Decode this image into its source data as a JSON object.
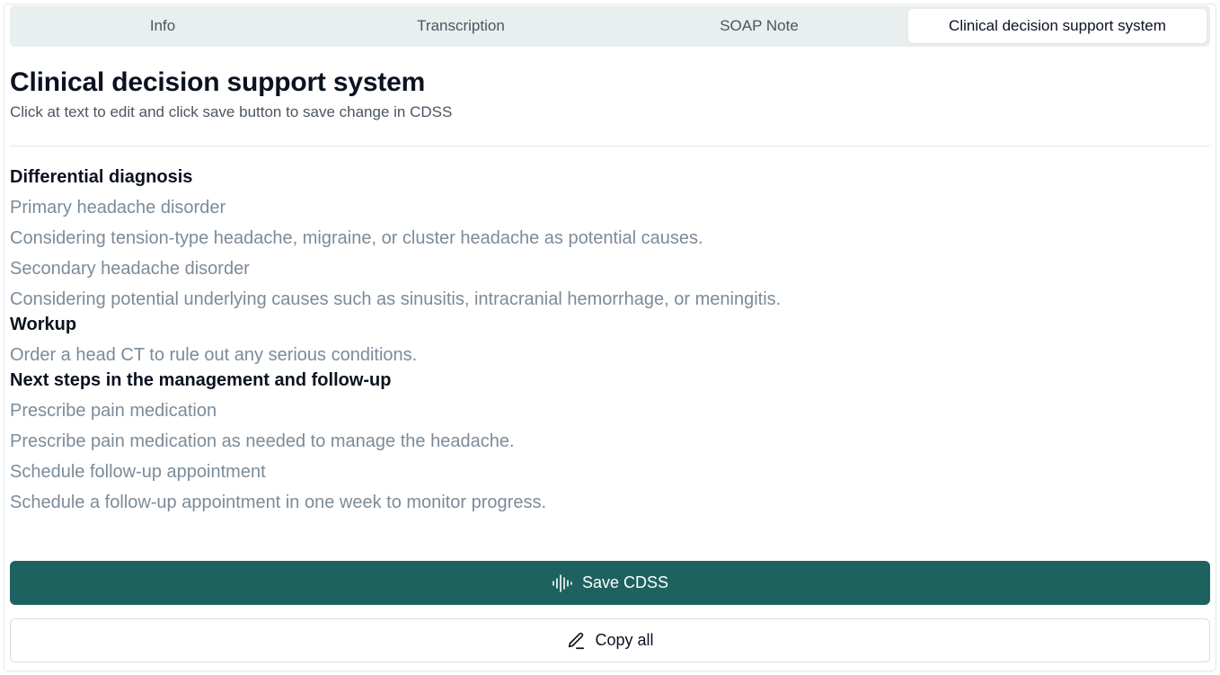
{
  "tabs": [
    {
      "label": "Info",
      "active": false
    },
    {
      "label": "Transcription",
      "active": false
    },
    {
      "label": "SOAP Note",
      "active": false
    },
    {
      "label": "Clinical decision support system",
      "active": true
    }
  ],
  "header": {
    "title": "Clinical decision support system",
    "subtitle": "Click at text to edit and click save button to save change in CDSS"
  },
  "sections": [
    {
      "title": "Differential diagnosis",
      "items": [
        "Primary headache disorder",
        "Considering tension-type headache, migraine, or cluster headache as potential causes.",
        "Secondary headache disorder",
        "Considering potential underlying causes such as sinusitis, intracranial hemorrhage, or meningitis."
      ]
    },
    {
      "title": "Workup",
      "items": [
        "Order a head CT to rule out any serious conditions."
      ]
    },
    {
      "title": "Next steps in the management and follow-up",
      "items": [
        "Prescribe pain medication",
        "Prescribe pain medication as needed to manage the headache.",
        "Schedule follow-up appointment",
        "Schedule a follow-up appointment in one week to monitor progress."
      ]
    }
  ],
  "buttons": {
    "save_label": "Save CDSS",
    "save_icon": "audio-waveform-icon",
    "copy_label": "Copy all",
    "copy_icon": "pen-icon"
  },
  "colors": {
    "accent": "#1e6260",
    "muted_text": "#7c8b99",
    "tab_bar_bg": "#e9eeee"
  }
}
